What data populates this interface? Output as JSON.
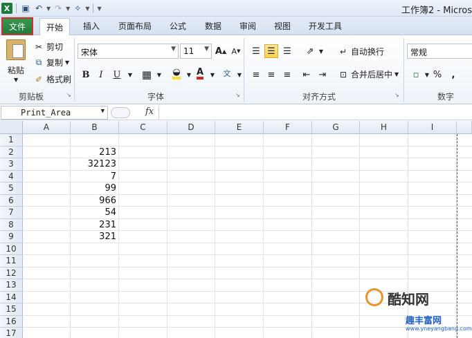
{
  "window": {
    "title": "工作簿2 - Micros"
  },
  "tabs": {
    "file": "文件",
    "items": [
      "开始",
      "插入",
      "页面布局",
      "公式",
      "数据",
      "审阅",
      "视图",
      "开发工具"
    ]
  },
  "ribbon": {
    "clipboard": {
      "paste": "粘贴",
      "cut": "剪切",
      "copy": "复制",
      "format_painter": "格式刷",
      "label": "剪贴板"
    },
    "font": {
      "name": "宋体",
      "size": "11",
      "bold": "B",
      "italic": "I",
      "underline": "U",
      "label": "字体"
    },
    "alignment": {
      "wrap_text": "自动换行",
      "merge_center": "合并后居中",
      "label": "对齐方式"
    },
    "number": {
      "format": "常规",
      "percent": "%",
      "comma": ",",
      "label": "数字"
    }
  },
  "formula_bar": {
    "name_box": "Print_Area",
    "fx": "fx",
    "value": ""
  },
  "sheet": {
    "columns": [
      "A",
      "B",
      "C",
      "D",
      "E",
      "F",
      "G",
      "H",
      "I"
    ],
    "rows": [
      "1",
      "2",
      "3",
      "4",
      "5",
      "6",
      "7",
      "8",
      "9",
      "10",
      "11",
      "12",
      "13",
      "14",
      "15",
      "16",
      "17"
    ],
    "column_b_values": [
      "",
      "213",
      "32123",
      "7",
      "99",
      "966",
      "54",
      "231",
      "321"
    ]
  },
  "watermark": {
    "brand": "酷知网",
    "site": "趣丰富网",
    "url": "www.yneyangbang.com"
  },
  "colors": {
    "file_tab": "#217a3a",
    "highlight_outline": "#d23030",
    "ribbon_bg": "#eef3f9"
  }
}
